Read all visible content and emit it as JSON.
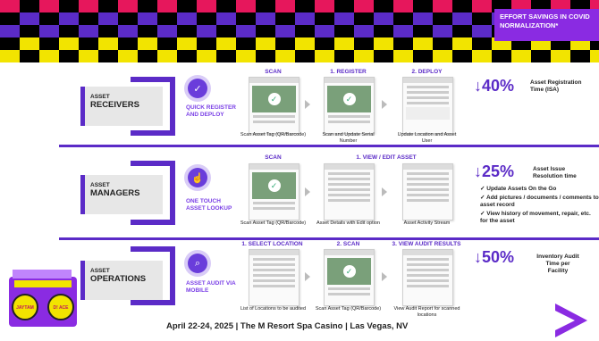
{
  "banner": {
    "text": "EFFORT SAVINGS IN COVID NORMALIZATION*"
  },
  "colors": {
    "purple": "#5b2bc7",
    "magenta": "#e6175c",
    "yellow": "#f2e400",
    "black": "#000000",
    "accent_purple": "#8a2be2"
  },
  "rows": [
    {
      "label_small": "ASSET",
      "label_big": "RECEIVERS",
      "feature": "QUICK REGISTER AND DEPLOY",
      "icon": "clock-check-icon",
      "steps": [
        {
          "title": "SCAN",
          "caption": "Scan Asset Tag (QR/Barcode)"
        },
        {
          "title": "1. REGISTER",
          "caption": "Scan and Update Serial Number"
        },
        {
          "title": "2. DEPLOY",
          "caption": "Update Location and Asset User"
        }
      ],
      "pct": "40%",
      "pct_desc": "Asset Registration Time (ISA)"
    },
    {
      "label_small": "ASSET",
      "label_big": "MANAGERS",
      "feature": "ONE TOUCH ASSET LOOKUP",
      "icon": "touch-icon",
      "steps": [
        {
          "title": "SCAN",
          "caption": "Scan Asset Tag (QR/Barcode)"
        },
        {
          "title": "1. VIEW / EDIT ASSET",
          "caption": "Asset Details with Edit option"
        },
        {
          "title": "",
          "caption": "Asset Activity Stream"
        }
      ],
      "pct": "25%",
      "pct_desc": "Asset Issue Resolution time"
    },
    {
      "label_small": "ASSET",
      "label_big": "OPERATIONS",
      "feature": "ASSET AUDIT VIA MOBILE",
      "icon": "search-icon",
      "steps": [
        {
          "title": "1. SELECT LOCATION",
          "caption": "List of Locations to be audited"
        },
        {
          "title": "2. SCAN",
          "caption": "Scan Asset Tag (QR/Barcode)"
        },
        {
          "title": "3. VIEW AUDIT RESULTS",
          "caption": "View Audit Report for scanned locations"
        }
      ],
      "pct": "50%",
      "pct_desc": "Inventory Audit Time per Facility"
    }
  ],
  "bullets": [
    "Update Assets On the Go",
    "Add pictures / documents / comments to asset record",
    "View history of movement, repair, etc. for the asset"
  ],
  "footer": {
    "text": "April 22-24, 2025 | The M Resort Spa Casino | Las Vegas, NV"
  },
  "radio": {
    "left_label": "JAYTAM",
    "right_label": "D! ACE"
  }
}
